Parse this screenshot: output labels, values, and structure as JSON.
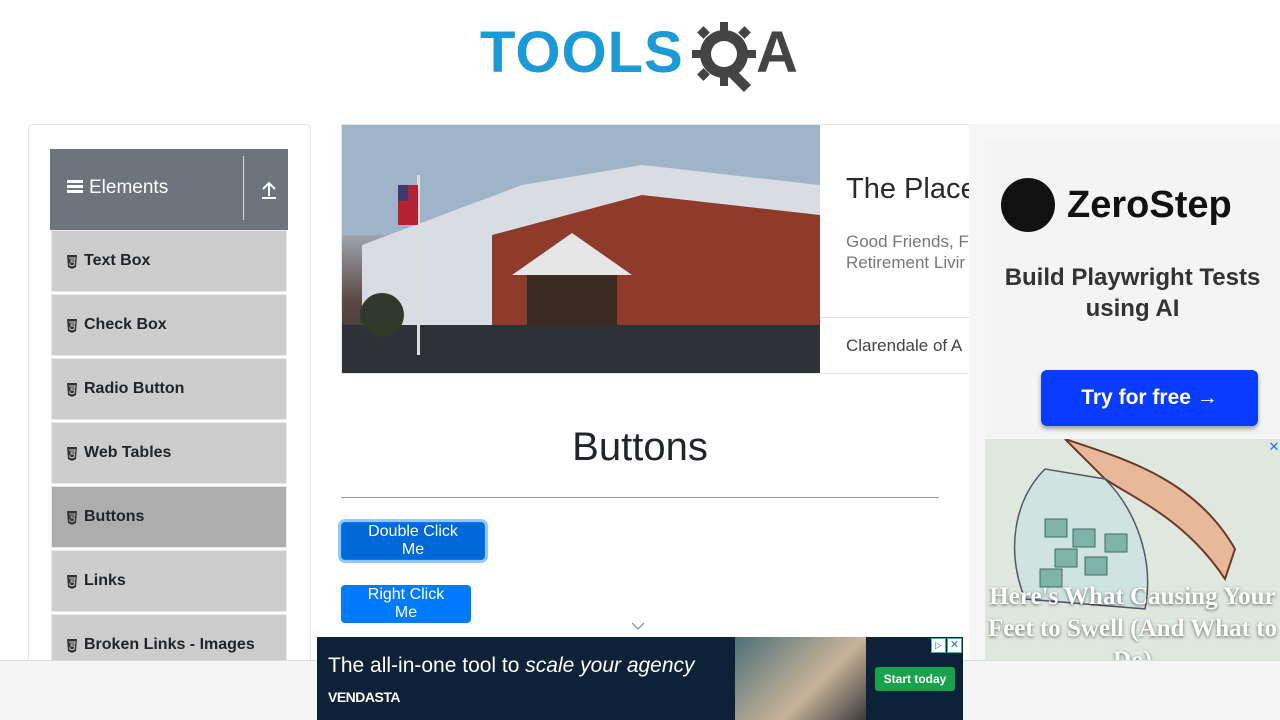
{
  "header": {
    "logo_text": "TOOLS",
    "logo_suffix": "A"
  },
  "sidebar": {
    "group_title": "Elements",
    "items": [
      {
        "label": "Text Box"
      },
      {
        "label": "Check Box"
      },
      {
        "label": "Radio Button"
      },
      {
        "label": "Web Tables"
      },
      {
        "label": "Buttons",
        "active": true
      },
      {
        "label": "Links"
      },
      {
        "label": "Broken Links - Images"
      }
    ]
  },
  "banner_ad": {
    "title": "The Place",
    "subtitle": "Good Friends, F Retirement Livir",
    "location": "Clarendale of A"
  },
  "main": {
    "heading": "Buttons",
    "double_click_label": "Double Click Me",
    "right_click_label": "Right Click Me"
  },
  "side_ad": {
    "brand": "ZeroStep",
    "tagline": "Build Playwright Tests using AI",
    "cta": "Try for free →",
    "headline": "Here's What Causing Your Feet to Swell (And What to Do)",
    "close": "✕"
  },
  "bottom_ad": {
    "text_plain": "The all-in-one tool to ",
    "text_italic": "scale your agency",
    "brand": "VENDASTA",
    "cta": "Start today",
    "adchoices": "▷",
    "close": "✕"
  },
  "colors": {
    "primary": "#007bff",
    "sidebar_header": "#6c757d",
    "menu_item": "#cdcdcd",
    "menu_item_active": "#adadad",
    "logo_blue": "#1b9ad6"
  }
}
